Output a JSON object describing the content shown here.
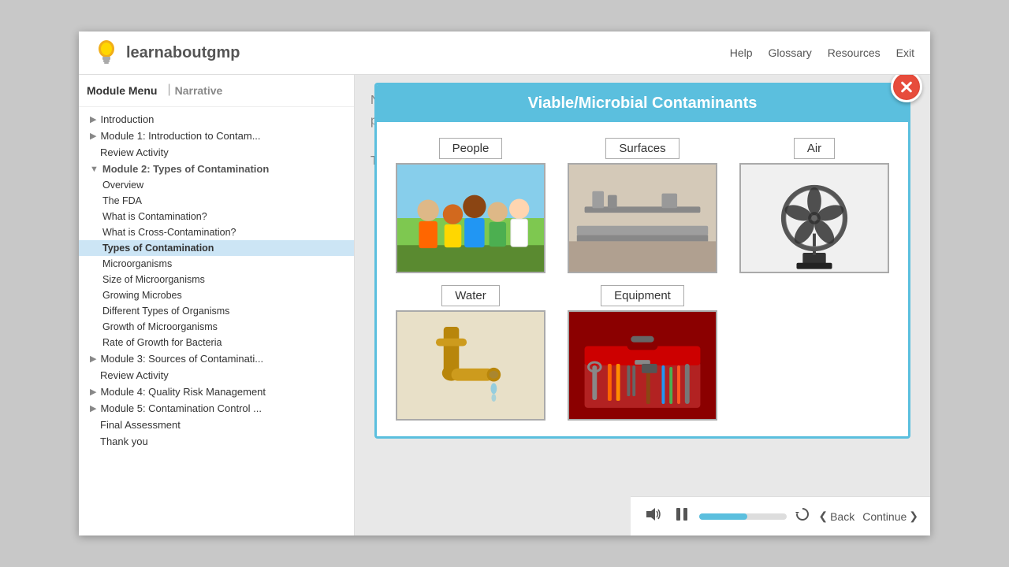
{
  "app": {
    "logo_text": "learnaboutgmp",
    "top_nav": [
      "Help",
      "Glossary",
      "Resources",
      "Exit"
    ]
  },
  "sidebar": {
    "tabs": [
      {
        "label": "Module Menu",
        "active": true
      },
      {
        "label": "Narrative",
        "active": false
      }
    ],
    "items": [
      {
        "id": "introduction",
        "label": "Introduction",
        "level": 1,
        "has_arrow": true,
        "arrow": "▶"
      },
      {
        "id": "module1",
        "label": "Module 1: Introduction to Contam...",
        "level": 1,
        "has_arrow": true,
        "arrow": "▶"
      },
      {
        "id": "review1",
        "label": "Review Activity",
        "level": 1,
        "has_arrow": false
      },
      {
        "id": "module2",
        "label": "Module 2: Types of Contamination",
        "level": 1,
        "has_arrow": true,
        "arrow": "▼",
        "expanded": true
      },
      {
        "id": "overview",
        "label": "Overview",
        "level": 2
      },
      {
        "id": "fda",
        "label": "The FDA",
        "level": 2
      },
      {
        "id": "what_is",
        "label": "What is Contamination?",
        "level": 2
      },
      {
        "id": "cross_cont",
        "label": "What is Cross-Contamination?",
        "level": 2
      },
      {
        "id": "types_cont",
        "label": "Types of Contamination",
        "level": 2,
        "active": true
      },
      {
        "id": "microorganisms",
        "label": "Microorganisms",
        "level": 2
      },
      {
        "id": "size_micro",
        "label": "Size of Microorganisms",
        "level": 2
      },
      {
        "id": "growing_microbes",
        "label": "Growing Microbes",
        "level": 2
      },
      {
        "id": "diff_types",
        "label": "Different Types of Organisms",
        "level": 2
      },
      {
        "id": "growth_micro",
        "label": "Growth of Microorganisms",
        "level": 2
      },
      {
        "id": "rate_growth",
        "label": "Rate of Growth for Bacteria",
        "level": 2
      },
      {
        "id": "module3",
        "label": "Module 3: Sources of Contaminati...",
        "level": 1,
        "has_arrow": true,
        "arrow": "▶"
      },
      {
        "id": "review3",
        "label": "Review Activity",
        "level": 1
      },
      {
        "id": "module4",
        "label": "Module 4: Quality Risk Management",
        "level": 1,
        "has_arrow": true,
        "arrow": "▶"
      },
      {
        "id": "module5",
        "label": "Module 5: Contamination Control ...",
        "level": 1,
        "has_arrow": true,
        "arrow": "▶"
      },
      {
        "id": "final",
        "label": "Final Assessment",
        "level": 1
      },
      {
        "id": "thankyou",
        "label": "Thank you",
        "level": 1
      }
    ]
  },
  "bg_content": {
    "line1": "Now we'll look at the different types of contaminants present in the",
    "line2": "pharmaceutical cleanroom environment.",
    "line3": "The following are key types of viable microbial contaminants:"
  },
  "modal": {
    "title": "Viable/Microbial Contaminants",
    "items": [
      {
        "id": "people",
        "label": "People",
        "type": "people"
      },
      {
        "id": "surfaces",
        "label": "Surfaces",
        "type": "surfaces"
      },
      {
        "id": "air",
        "label": "Air",
        "type": "air"
      },
      {
        "id": "water",
        "label": "Water",
        "type": "water"
      },
      {
        "id": "equipment",
        "label": "Equipment",
        "type": "equipment"
      }
    ]
  },
  "bottom_bar": {
    "back_label": "Back",
    "continue_label": "Continue",
    "progress": 55
  }
}
